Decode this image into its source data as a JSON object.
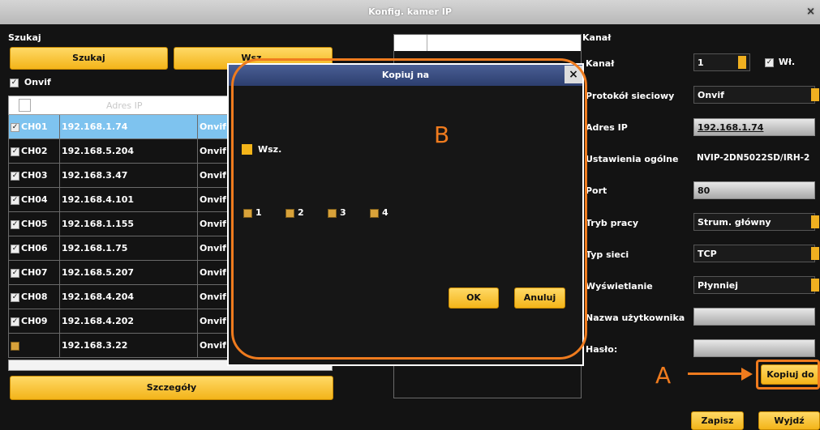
{
  "window": {
    "title": "Konfig. kamer IP",
    "close_icon": "×"
  },
  "left": {
    "section_label": "Szukaj",
    "search_button": "Szukaj",
    "all_button": "Wsz.",
    "onvif_checkbox": "Onvif",
    "table_header_partial": "Adres IP",
    "rows": [
      {
        "ch": "CH01",
        "ip": "192.168.1.74",
        "proto": "Onvif",
        "selected": true
      },
      {
        "ch": "CH02",
        "ip": "192.168.5.204",
        "proto": "Onvif",
        "selected": false
      },
      {
        "ch": "CH03",
        "ip": "192.168.3.47",
        "proto": "Onvif",
        "selected": false
      },
      {
        "ch": "CH04",
        "ip": "192.168.4.101",
        "proto": "Onvif",
        "selected": false
      },
      {
        "ch": "CH05",
        "ip": "192.168.1.155",
        "proto": "Onvif",
        "selected": false
      },
      {
        "ch": "CH06",
        "ip": "192.168.1.75",
        "proto": "Onvif",
        "selected": false
      },
      {
        "ch": "CH07",
        "ip": "192.168.5.207",
        "proto": "Onvif",
        "selected": false
      },
      {
        "ch": "CH08",
        "ip": "192.168.4.204",
        "proto": "Onvif",
        "selected": false
      },
      {
        "ch": "CH09",
        "ip": "192.168.4.202",
        "proto": "Onvif",
        "selected": false
      },
      {
        "ch": "",
        "ip": "192.168.3.22",
        "proto": "Onvif",
        "selected": false
      }
    ],
    "details_button": "Szczegóły"
  },
  "right": {
    "section_label": "Kanał",
    "channel_label": "Kanał",
    "channel_value": "1",
    "enable_label": "Wł.",
    "protocol_label": "Protokół sieciowy",
    "protocol_value": "Onvif",
    "ip_label": "Adres IP",
    "ip_value": "192.168.1.74",
    "general_label": "Ustawienia ogólne",
    "general_value": "NVIP-2DN5022SD/IRH-2",
    "port_label": "Port",
    "port_value": "80",
    "mode_label": "Tryb pracy",
    "mode_value": "Strum. główny",
    "net_label": "Typ sieci",
    "net_value": "TCP",
    "display_label": "Wyświetlanie",
    "display_value": "Płynniej",
    "user_label": "Nazwa użytkownika",
    "pass_label": "Hasło:",
    "copy_button": "Kopiuj do",
    "save_button": "Zapisz",
    "exit_button": "Wyjdź"
  },
  "dialog": {
    "title": "Kopiuj na",
    "close_icon": "×",
    "all_label": "Wsz.",
    "channels": [
      "1",
      "2",
      "3",
      "4"
    ],
    "ok_button": "OK",
    "cancel_button": "Anuluj"
  },
  "annotations": {
    "a_label": "A",
    "b_label": "B"
  },
  "colors": {
    "accent": "#f3b419",
    "annotation": "#ef7b1e",
    "selected_row": "#7ec3ef"
  }
}
